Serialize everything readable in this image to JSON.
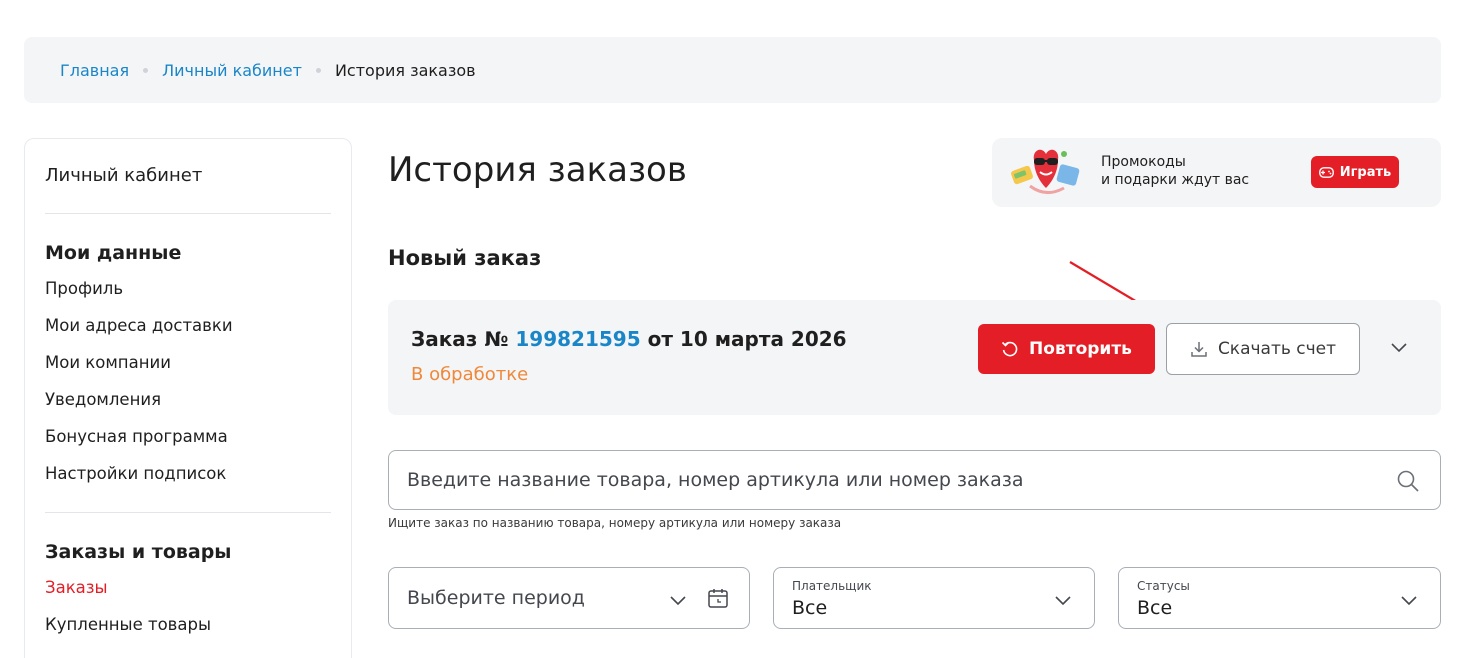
{
  "breadcrumbs": {
    "home": "Главная",
    "account": "Личный кабинет",
    "current": "История заказов"
  },
  "sidebar": {
    "title": "Личный кабинет",
    "group1": {
      "title": "Мои данные",
      "items": [
        "Профиль",
        "Мои адреса доставки",
        "Мои компании",
        "Уведомления",
        "Бонусная программа",
        "Настройки подписок"
      ]
    },
    "group2": {
      "title": "Заказы и товары",
      "items": [
        "Заказы",
        "Купленные товары"
      ],
      "active": "Заказы"
    }
  },
  "page": {
    "title": "История заказов",
    "section_title": "Новый заказ"
  },
  "promo": {
    "line1": "Промокоды",
    "line2": "и подарки ждут вас",
    "button": "Играть"
  },
  "order": {
    "prefix": "Заказ №",
    "number": "199821595",
    "suffix": "от 10 марта 2026",
    "status": "В обработке",
    "repeat_label": "Повторить",
    "download_label": "Скачать счет"
  },
  "search": {
    "placeholder": "Введите название товара, номер артикула или номер заказа",
    "hint": "Ищите заказ по названию товара, номеру артикула или номеру заказа"
  },
  "filters": {
    "period_placeholder": "Выберите период",
    "payer": {
      "label": "Плательщик",
      "value": "Все"
    },
    "statuses": {
      "label": "Статусы",
      "value": "Все"
    }
  },
  "colors": {
    "accent_red": "#e41e26",
    "link_blue": "#1a86c8",
    "status_orange": "#f0883a",
    "panel_gray": "#f4f5f7"
  }
}
